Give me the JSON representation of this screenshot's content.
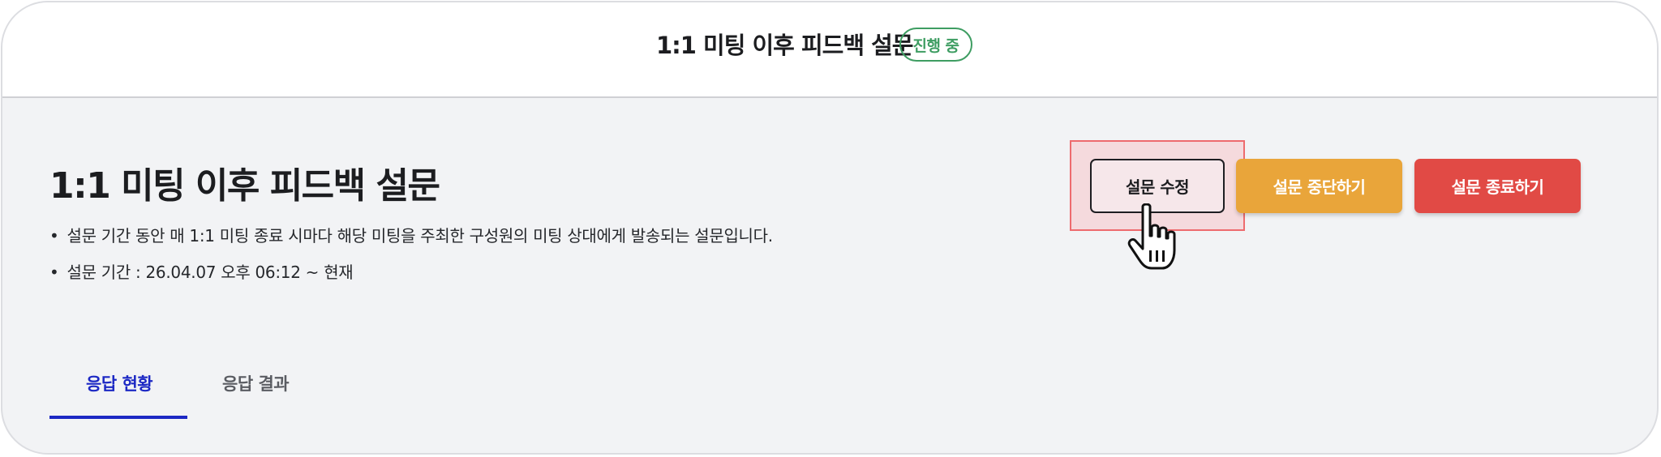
{
  "header": {
    "title": "1:1 미팅 이후 피드백 설문",
    "status_badge": "진행 중",
    "status_color": "#3e9d62"
  },
  "survey": {
    "title": "1:1 미팅 이후 피드백 설문",
    "bullet": "•",
    "description": "설문 기간 동안 매 1:1 미팅 종료 시마다 해당 미팅을 주최한 구성원의 미팅 상대에게 발송되는 설문입니다.",
    "period": "설문 기간 : 26.04.07 오후 06:12 ~ 현재"
  },
  "actions": {
    "edit_label": "설문 수정",
    "pause_label": "설문 중단하기",
    "close_label": "설문 종료하기",
    "pause_color": "#e9a53a",
    "close_color": "#e14a45"
  },
  "tabs": [
    {
      "label": "응답 현황",
      "active": true
    },
    {
      "label": "응답 결과",
      "active": false
    }
  ],
  "accent_color": "#1c28c4",
  "cursor": {
    "icon": "hand-pointer-icon"
  }
}
